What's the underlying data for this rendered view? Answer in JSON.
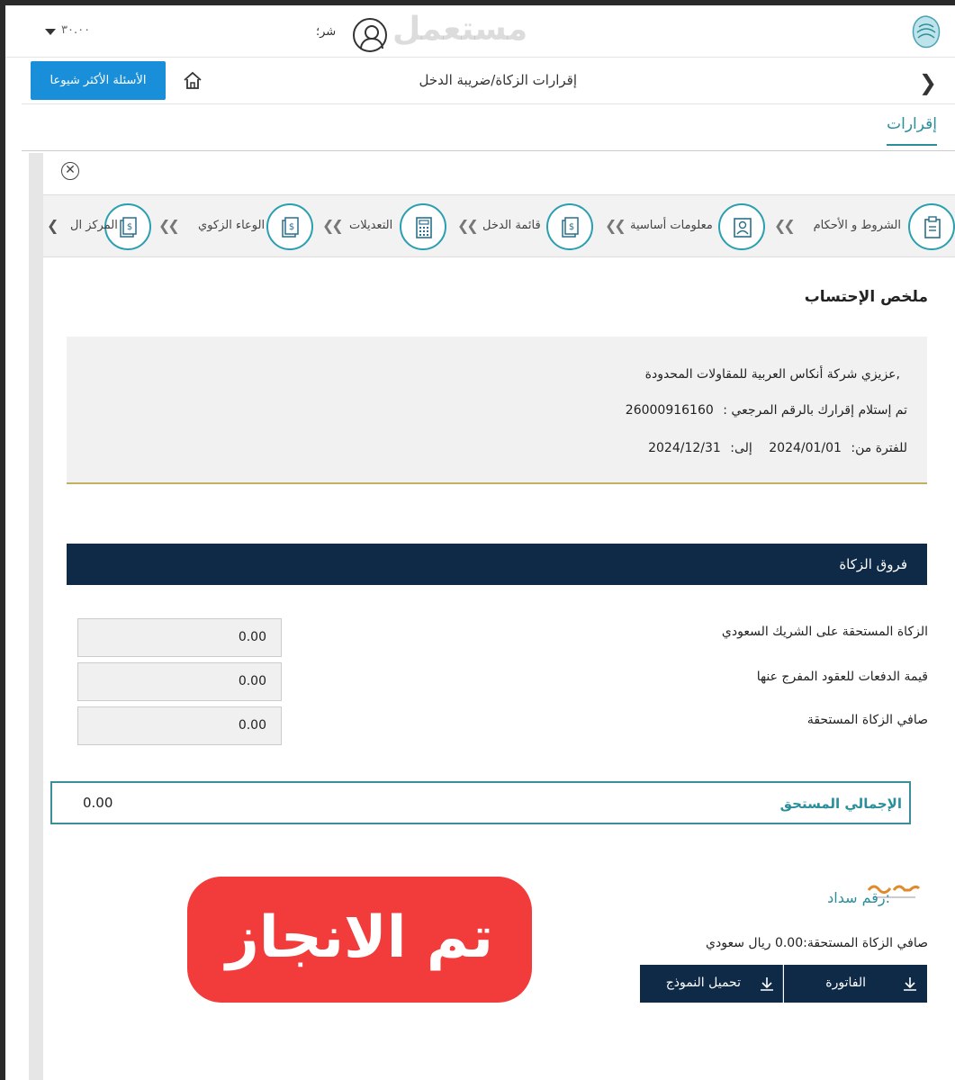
{
  "topbar": {
    "watermark": "مستعمل",
    "user_label": "شر؛",
    "lang_value": "٣٠.٠٠"
  },
  "nav": {
    "title": "إقرارات الزكاة/ضريبة الدخل",
    "faq_button": "الأسئلة الأكثر شيوعا"
  },
  "tabs": {
    "active": "إقرارات"
  },
  "steps": [
    {
      "label": "الشروط و الأحكام",
      "icon": "clipboard-icon"
    },
    {
      "label": "معلومات أساسية",
      "icon": "user-card-icon"
    },
    {
      "label": "قائمة الدخل",
      "icon": "money-doc-icon"
    },
    {
      "label": "التعديلات",
      "icon": "calculator-icon"
    },
    {
      "label": "الوعاء الزكوي",
      "icon": "money-doc-icon"
    },
    {
      "label": "المركز ال",
      "icon": "money-doc-icon"
    }
  ],
  "summary": {
    "title": "ملخص الإحتساب",
    "greeting_label": "عزيزي",
    "company": "شركة أنكاس العربية للمقاولات المحدودة,",
    "ref_label": "تم إستلام إقرارك بالرقم المرجعي :",
    "ref_number": "26000916160",
    "period_from_label": "للفترة من:",
    "period_from": "2024/01/01",
    "period_to_label": "إلى:",
    "period_to": "2024/12/31"
  },
  "zakat_diff": {
    "header": "فروق الزكاة",
    "rows": [
      {
        "label": "الزكاة المستحقة على الشريك السعودي",
        "value": "0.00"
      },
      {
        "label": "قيمة الدفعات للعقود المفرج عنها",
        "value": "0.00"
      },
      {
        "label": "صافي الزكاة المستحقة",
        "value": "0.00"
      }
    ]
  },
  "total": {
    "label": "الإجمالي المستحق",
    "value": "0.00"
  },
  "sadad": {
    "label": "رقم سداد:",
    "net_text": "صافي الزكاة المستحقة:0.00  ريال سعودي"
  },
  "buttons": {
    "invoice": "الفاتورة",
    "download_form": "تحميل النموذج"
  },
  "badge": {
    "text": "تم الانجاز"
  },
  "colors": {
    "accent": "#2a8f9b",
    "navy": "#0e2a47",
    "faq_blue": "#1a8fd9",
    "badge_red": "#f23b3b"
  }
}
